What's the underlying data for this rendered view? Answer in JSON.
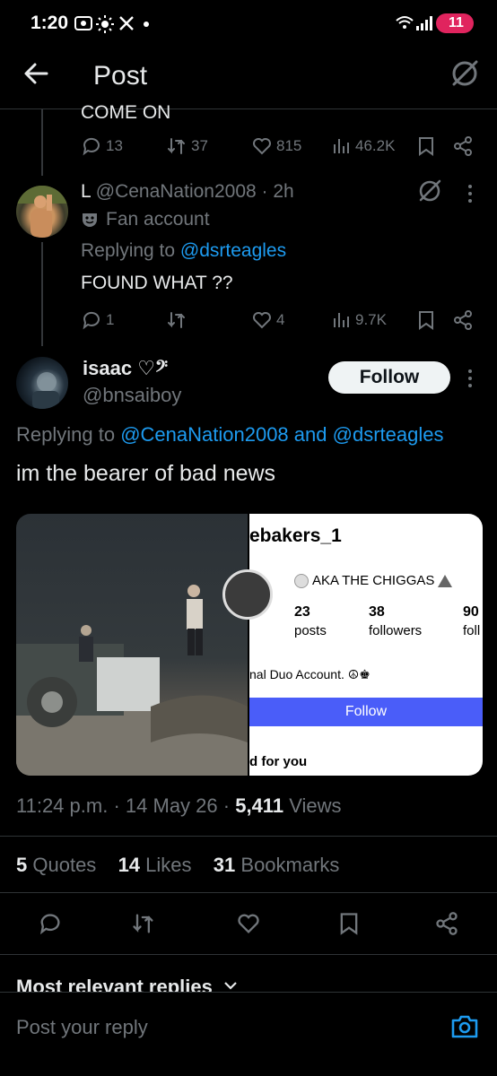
{
  "status_bar": {
    "time": "1:20",
    "battery": "11"
  },
  "header": {
    "title": "Post"
  },
  "prev_tweet": {
    "text_fragment": "COME ON",
    "replies": "13",
    "reposts": "37",
    "likes": "815",
    "views": "46.2K"
  },
  "reply_tweet": {
    "name": "L",
    "handle": "@CenaNation2008",
    "time": "· 2h",
    "label": "Fan account",
    "replying_prefix": "Replying to",
    "replying_to": "@dsrteagles",
    "text": "FOUND WHAT ??",
    "replies": "1",
    "reposts": "",
    "likes": "4",
    "views": "9.7K"
  },
  "main_tweet": {
    "name": "isaac",
    "name_emoji": "♡𝄢",
    "handle": "@bnsaiboy",
    "follow_label": "Follow",
    "replying_prefix": "Replying to",
    "replying_to_1": "@CenaNation2008",
    "replying_and": "and",
    "replying_to_2": "@dsrteagles",
    "text": "im the bearer of bad news",
    "media_right": {
      "username": "ebakers_1",
      "bio_name": "AKA THE CHIGGAS",
      "posts_count": "23",
      "posts_label": "posts",
      "followers_count": "38",
      "followers_label": "followers",
      "following_count": "90",
      "following_label": "foll",
      "bio": "nal Duo Account. ☮♚",
      "follow_label": "Follow",
      "footer": "d for you"
    },
    "timestamp_time": "11:24 p.m.",
    "timestamp_date": "14 May 26",
    "views_count": "5,411",
    "views_label": "Views",
    "quotes_count": "5",
    "quotes_label": "Quotes",
    "likes_count": "14",
    "likes_label": "Likes",
    "bookmarks_count": "31",
    "bookmarks_label": "Bookmarks"
  },
  "replies_section": {
    "sort_label": "Most relevant replies"
  },
  "reply_bar": {
    "placeholder": "Post your reply"
  },
  "icons": {
    "accent": "#1d9bf0"
  }
}
